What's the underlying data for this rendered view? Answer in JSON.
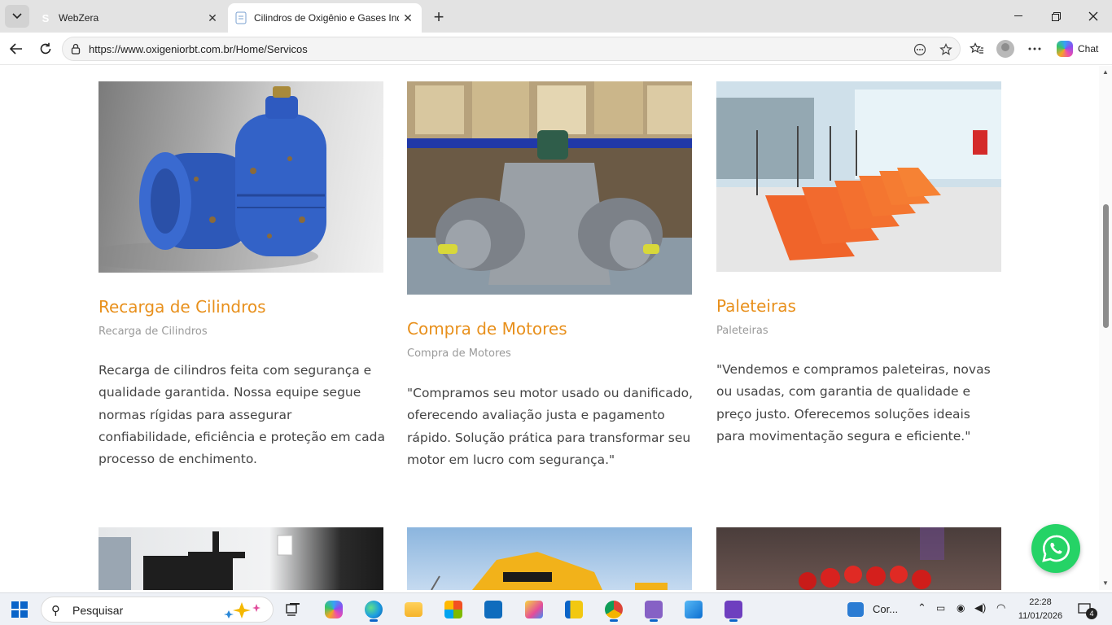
{
  "browser": {
    "tabs": [
      {
        "title": "WebZera",
        "favicon": "S",
        "active": false
      },
      {
        "title": "Cilindros de Oxigênio e Gases Indu",
        "active": true
      }
    ],
    "url": "https://www.oxigeniorbt.com.br/Home/Servicos",
    "chat_label": "Chat"
  },
  "services": [
    {
      "title": "Recarga de Cilindros",
      "subtitle": "Recarga de Cilindros",
      "description": "Recarga de cilindros feita com segurança e qualidade garantida. Nossa equipe segue normas rígidas para assegurar confiabilidade, eficiência e proteção em cada processo de enchimento."
    },
    {
      "title": "Compra de Motores",
      "subtitle": "Compra de Motores",
      "description": "\"Compramos seu motor usado ou danificado, oferecendo avaliação justa e pagamento rápido. Solução prática para transformar seu motor em lucro com segurança.\""
    },
    {
      "title": "Paleteiras",
      "subtitle": "Paleteiras",
      "description": "\"Vendemos e compramos paleteiras, novas ou usadas, com garantia de qualidade e preço justo. Oferecemos soluções ideais para movimentação segura e eficiente.\""
    }
  ],
  "taskbar": {
    "search_placeholder": "Pesquisar",
    "weather_text": "Cor...",
    "time": "22:28",
    "date": "11/01/2026",
    "notifications": "4"
  },
  "colors": {
    "accent": "#e8901c",
    "whatsapp": "#25d366"
  }
}
